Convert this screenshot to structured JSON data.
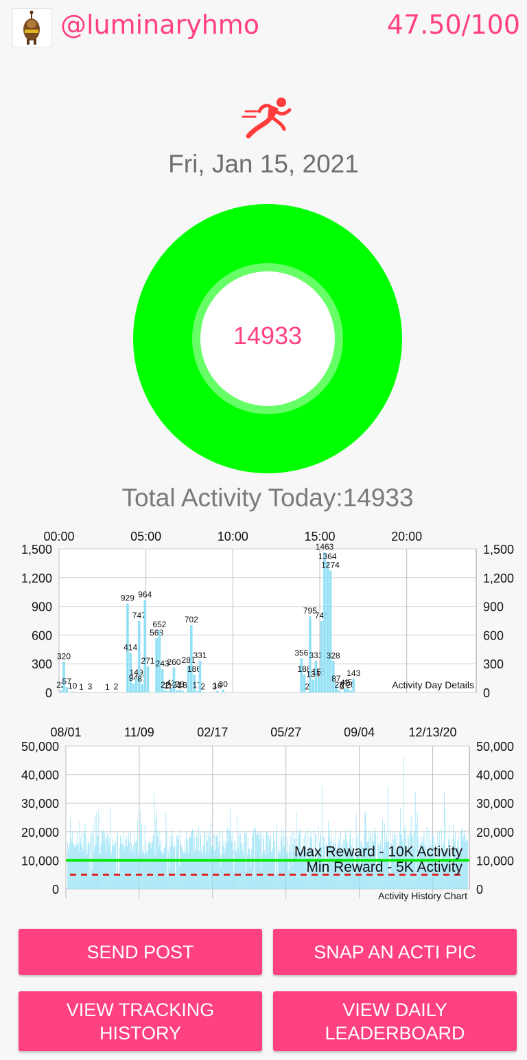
{
  "header": {
    "username": "@luminaryhmo",
    "score": "47.50/100",
    "avatar_icon": "robot-avatar-icon"
  },
  "activity_icon": "running-person-icon",
  "date": "Fri, Jan 15, 2021",
  "ring": {
    "value": "14933",
    "progress_fraction": 1.0,
    "ring_color": "#00ff00",
    "inner_halo_color": "#66ff66"
  },
  "total_label": "Total Activity Today:14933",
  "colors": {
    "accent": "#ff4081",
    "bar": "#91e0f5",
    "max_line": "#00e600",
    "min_line": "#e02020"
  },
  "buttons": {
    "send_post": "SEND POST",
    "snap_pic": "SNAP AN ACTI PIC",
    "tracking_history": "VIEW TRACKING\nHISTORY",
    "daily_leaderboard": "VIEW DAILY\nLEADERBOARD"
  },
  "chart_data": [
    {
      "type": "bar",
      "caption": "Activity Day Details",
      "x_unit": "minutes since 00:00 (10-minute bins)",
      "x_ticks": [
        "00:00",
        "05:00",
        "10:00",
        "15:00",
        "20:00"
      ],
      "x_tick_minutes": [
        0,
        300,
        600,
        900,
        1200
      ],
      "xlim": [
        0,
        1440
      ],
      "y_ticks": [
        "0",
        "300",
        "600",
        "900",
        "1,200",
        "1,500"
      ],
      "ylim": [
        0,
        1500
      ],
      "grid": true,
      "points": [
        {
          "x": 0,
          "v": 22
        },
        {
          "x": 10,
          "v": 320
        },
        {
          "x": 20,
          "v": 57
        },
        {
          "x": 40,
          "v": 10
        },
        {
          "x": 70,
          "v": 1
        },
        {
          "x": 100,
          "v": 3
        },
        {
          "x": 160,
          "v": 1
        },
        {
          "x": 190,
          "v": 2
        },
        {
          "x": 230,
          "v": 929
        },
        {
          "x": 240,
          "v": 414
        },
        {
          "x": 250,
          "v": 94
        },
        {
          "x": 260,
          "v": 149
        },
        {
          "x": 270,
          "v": 747
        },
        {
          "x": 280,
          "v": 87
        },
        {
          "x": 290,
          "v": 964
        },
        {
          "x": 300,
          "v": 271
        },
        {
          "x": 330,
          "v": 568
        },
        {
          "x": 340,
          "v": 652
        },
        {
          "x": 350,
          "v": 243
        },
        {
          "x": 360,
          "v": 22
        },
        {
          "x": 370,
          "v": 11
        },
        {
          "x": 380,
          "v": 42
        },
        {
          "x": 390,
          "v": 260
        },
        {
          "x": 400,
          "v": 21
        },
        {
          "x": 410,
          "v": 28
        },
        {
          "x": 420,
          "v": 18
        },
        {
          "x": 440,
          "v": 281
        },
        {
          "x": 450,
          "v": 702
        },
        {
          "x": 460,
          "v": 186
        },
        {
          "x": 470,
          "v": 17
        },
        {
          "x": 480,
          "v": 331
        },
        {
          "x": 490,
          "v": 2
        },
        {
          "x": 530,
          "v": 3
        },
        {
          "x": 540,
          "v": 16
        },
        {
          "x": 560,
          "v": 30
        },
        {
          "x": 830,
          "v": 356
        },
        {
          "x": 840,
          "v": 188
        },
        {
          "x": 850,
          "v": 2
        },
        {
          "x": 860,
          "v": 795
        },
        {
          "x": 870,
          "v": 134
        },
        {
          "x": 880,
          "v": 331
        },
        {
          "x": 890,
          "v": 158
        },
        {
          "x": 900,
          "v": 746
        },
        {
          "x": 910,
          "v": 1463
        },
        {
          "x": 920,
          "v": 1364
        },
        {
          "x": 930,
          "v": 1274
        },
        {
          "x": 940,
          "v": 328
        },
        {
          "x": 950,
          "v": 87
        },
        {
          "x": 960,
          "v": 23
        },
        {
          "x": 970,
          "v": 5
        },
        {
          "x": 980,
          "v": 42
        },
        {
          "x": 990,
          "v": 45
        },
        {
          "x": 1000,
          "v": 20
        },
        {
          "x": 1010,
          "v": 143
        }
      ]
    },
    {
      "type": "bar",
      "caption": "Activity History Chart",
      "x_ticks": [
        "08/01",
        "11/09",
        "02/17",
        "05/27",
        "09/04",
        "12/13/20"
      ],
      "y_ticks": [
        "0",
        "10,000",
        "20,000",
        "30,000",
        "40,000",
        "50,000"
      ],
      "ylim": [
        0,
        50000
      ],
      "grid": true,
      "reference_lines": [
        {
          "label": "Max Reward - 10K Activity",
          "value": 10000,
          "style": "solid"
        },
        {
          "label": "Min Reward - 5K Activity",
          "value": 5000,
          "style": "dashed"
        }
      ],
      "series_summary": "roughly 590 daily bars, typically 10,000-22,000, peaks near 46,000 (Sept) and 34,000 (Dec)"
    }
  ]
}
